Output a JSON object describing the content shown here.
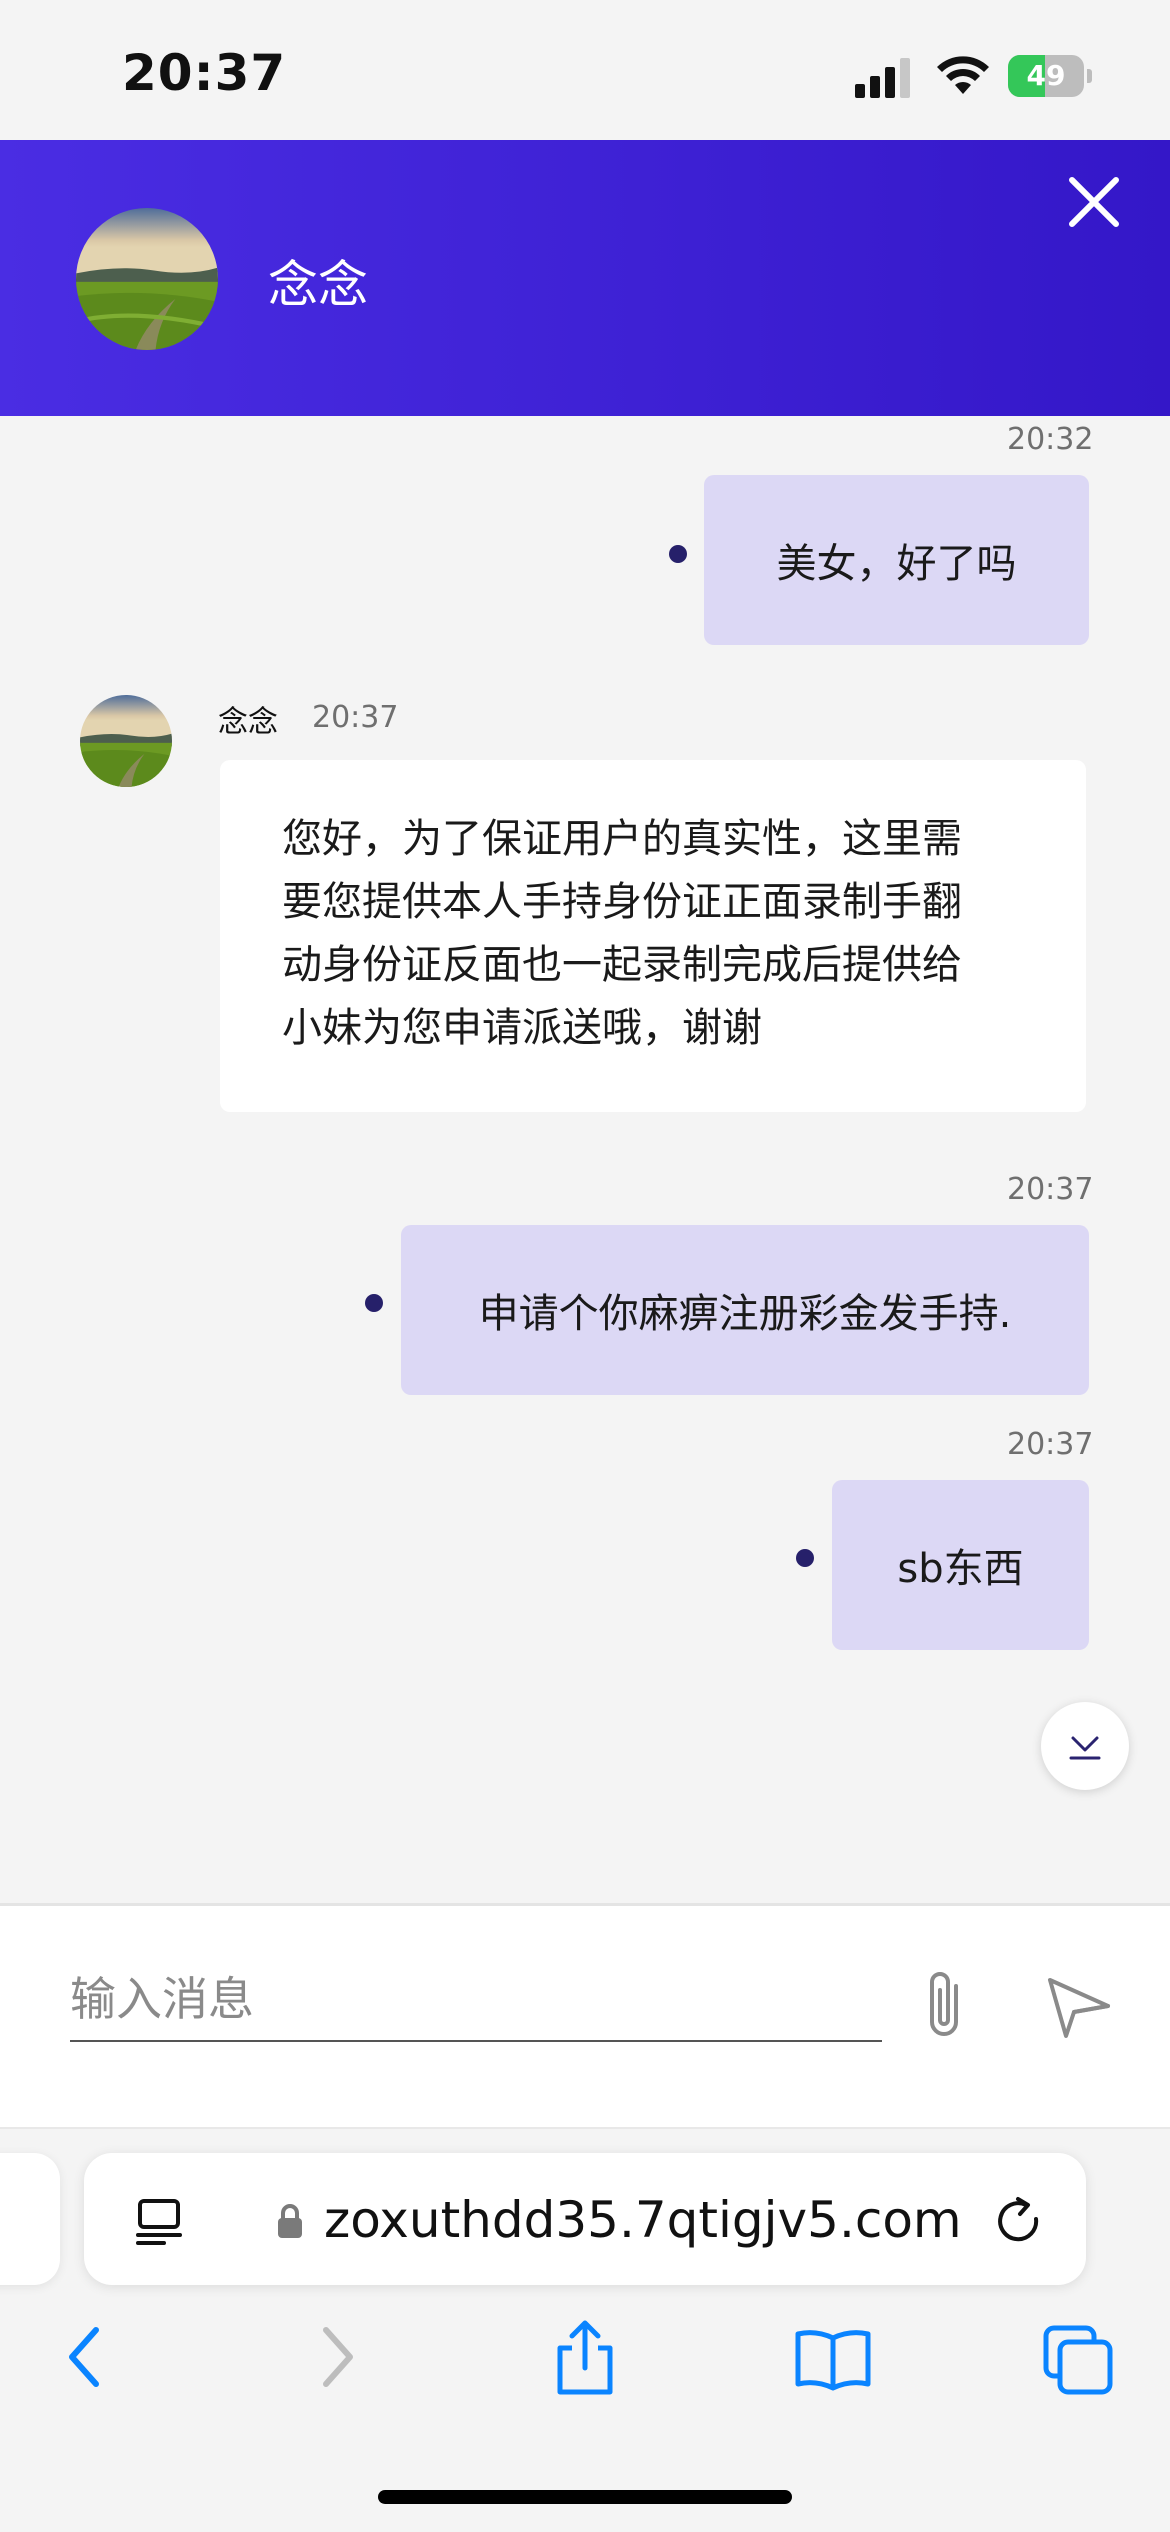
{
  "status_bar": {
    "time": "20:37",
    "battery": "49",
    "battery_level": 0.49
  },
  "header": {
    "contact_name": "念念",
    "close_icon": "close-icon"
  },
  "messages": [
    {
      "direction": "outgoing",
      "time": "20:32",
      "text": "美女，好了吗"
    },
    {
      "direction": "incoming",
      "sender": "念念",
      "time": "20:37",
      "lines": [
        "您好，为了保证用户的真实性，这里需",
        "要您提供本人手持身份证正面录制手翻",
        "动身份证反面也一起录制完成后提供给",
        "小妹为您申请派送哦，谢谢"
      ]
    },
    {
      "direction": "outgoing",
      "time": "20:37",
      "text": "申请个你麻痹注册彩金发手持."
    },
    {
      "direction": "outgoing",
      "time": "20:37",
      "text": "sb东西"
    }
  ],
  "composer": {
    "placeholder": "输入消息",
    "attach_icon": "paperclip-icon",
    "send_icon": "send-icon"
  },
  "browser": {
    "url": "zoxuthdd35.7qtigjv5.com",
    "accent_color": "#0a84ff"
  },
  "colors": {
    "header_start": "#4a2de3",
    "header_end": "#3417c8",
    "outgoing_bubble": "#dcd8f5",
    "incoming_bubble": "#ffffff"
  }
}
